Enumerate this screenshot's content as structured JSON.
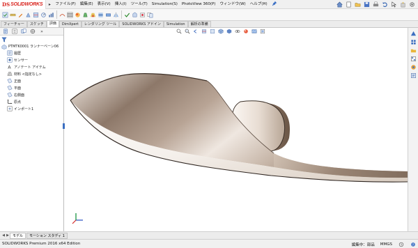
{
  "app": {
    "logo_ds": "DS",
    "logo_text": "SOLIDWORKS"
  },
  "menu": {
    "expand_arrow": "▸",
    "items": [
      "ファイル(F)",
      "編集(E)",
      "表示(V)",
      "挿入(I)",
      "ツール(T)",
      "Simulation(S)",
      "PhotoView 360(P)",
      "ウィンドウ(W)",
      "ヘルプ(H)"
    ],
    "pin_icon": "pushpin-icon"
  },
  "command_tabs": [
    "フィーチャー",
    "スケッチ",
    "評価",
    "DimXpert",
    "レンダリング ツール",
    "SOLIDWORKS アドイン",
    "Simulation",
    "解析の準備"
  ],
  "command_tabs_active": 2,
  "feature_manager": {
    "tabs": [
      "featuremanager-icon",
      "propertymanager-icon",
      "configurationmanager-icon",
      "dimxpert-icon"
    ],
    "more": "»",
    "root_label": "PTMTK0001 ランナーベーン06",
    "items": [
      {
        "label": "履歴",
        "icon": "history-icon"
      },
      {
        "label": "センサー",
        "icon": "sensor-icon"
      },
      {
        "label": "アノテート アイテム",
        "icon": "annotation-icon"
      },
      {
        "label": "材料 <指定なし>",
        "icon": "material-icon"
      },
      {
        "label": "正面",
        "icon": "plane-icon"
      },
      {
        "label": "平面",
        "icon": "plane-icon"
      },
      {
        "label": "右側面",
        "icon": "plane-icon"
      },
      {
        "label": "原点",
        "icon": "origin-icon"
      },
      {
        "label": "インポート1",
        "icon": "import-icon"
      }
    ]
  },
  "model_tabs": [
    "モデル",
    "モーション スタディ 1"
  ],
  "model_tabs_active": 0,
  "status": {
    "edition": "SOLIDWORKS Premium 2016 x64 Edition",
    "editing": "編集中：部品",
    "units": "MMGS"
  },
  "colors": {
    "blade_light": "#f6efe9",
    "blade_mid": "#b3a08f",
    "blade_dark": "#6e5b4c",
    "accent_blue": "#2f63c0",
    "logo_red": "#d9231d"
  }
}
